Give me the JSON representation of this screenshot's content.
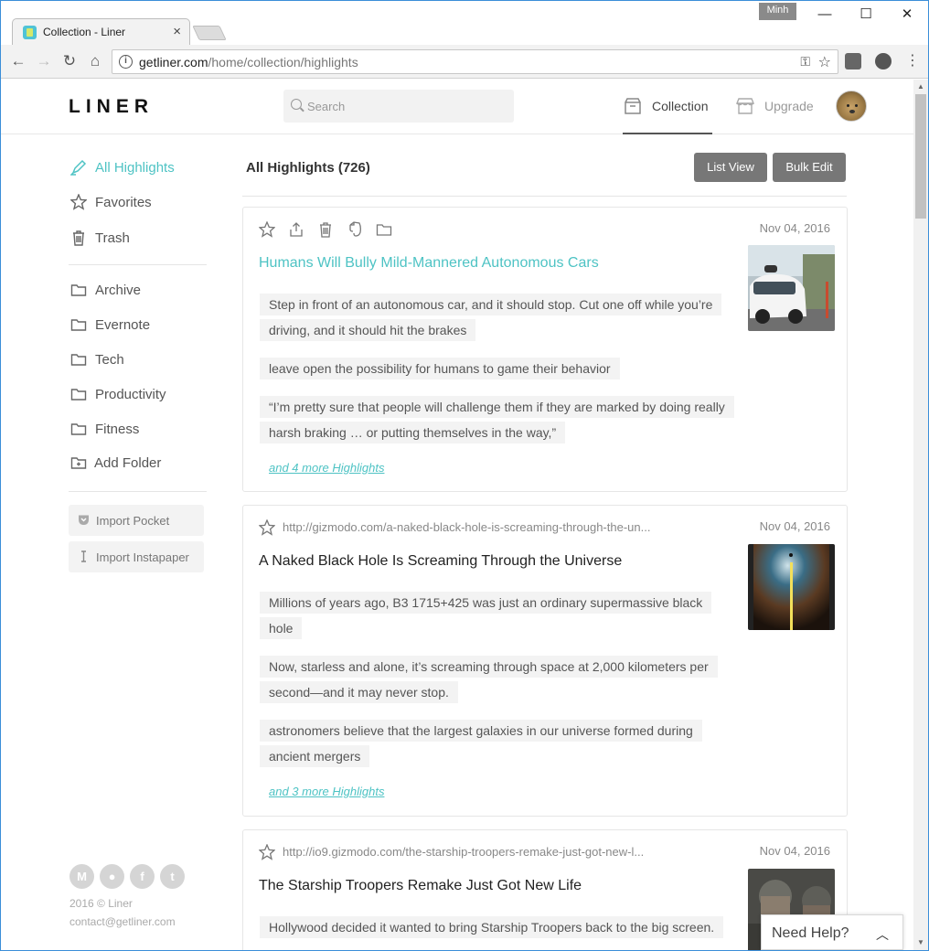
{
  "browser": {
    "tab_title": "Collection - Liner",
    "tab_close": "×",
    "user_badge": "Minh",
    "window_controls": {
      "minimize": "—",
      "maximize": "☐",
      "close": "✕"
    },
    "url_host": "getliner.com",
    "url_path": "/home/collection/highlights",
    "nav": {
      "back": "←",
      "forward": "→",
      "reload": "↻",
      "home": "⌂"
    },
    "menu": "⋮"
  },
  "header": {
    "logo": "LINER",
    "search_placeholder": "Search",
    "nav": [
      {
        "label": "Collection",
        "icon": "archive-box-icon",
        "active": true
      },
      {
        "label": "Upgrade",
        "icon": "storefront-icon",
        "active": false
      }
    ]
  },
  "sidebar": {
    "main": [
      {
        "label": "All Highlights",
        "icon": "highlighter-icon",
        "active": true
      },
      {
        "label": "Favorites",
        "icon": "star-icon",
        "active": false
      },
      {
        "label": "Trash",
        "icon": "trash-icon",
        "active": false
      }
    ],
    "folders": [
      {
        "label": "Archive",
        "icon": "folder-icon"
      },
      {
        "label": "Evernote",
        "icon": "folder-icon"
      },
      {
        "label": "Tech",
        "icon": "folder-icon"
      },
      {
        "label": "Productivity",
        "icon": "folder-icon"
      },
      {
        "label": "Fitness",
        "icon": "folder-icon"
      }
    ],
    "add_folder": "Add Folder",
    "imports": [
      {
        "label": "Import Pocket",
        "icon": "pocket-icon"
      },
      {
        "label": "Import Instapaper",
        "icon": "instapaper-icon"
      }
    ],
    "footer": {
      "social": [
        {
          "name": "medium-icon",
          "glyph": "M"
        },
        {
          "name": "reddit-icon",
          "glyph": "●"
        },
        {
          "name": "facebook-icon",
          "glyph": "f"
        },
        {
          "name": "twitter-icon",
          "glyph": "t"
        }
      ],
      "copyright": "2016 © Liner",
      "contact": "contact@getliner.com"
    }
  },
  "main": {
    "title": "All Highlights (726)",
    "list_view_label": "List View",
    "bulk_edit_label": "Bulk Edit",
    "cards": [
      {
        "date": "Nov 04, 2016",
        "title": "Humans Will Bully Mild-Mannered Autonomous Cars",
        "highlights": [
          "Step in front of an autonomous car, and it should stop. Cut one off while you’re driving, and it should hit the brakes",
          "leave open the possibility for humans to game their behavior",
          "“I’m pretty sure that people will challenge them if they are marked by doing really harsh braking … or putting themselves in the way,”"
        ],
        "more": "and 4 more Highlights"
      },
      {
        "date": "Nov 04, 2016",
        "source": "http://gizmodo.com/a-naked-black-hole-is-screaming-through-the-un...",
        "title": "A Naked Black Hole Is Screaming Through the Universe",
        "highlights": [
          "Millions of years ago, B3 1715+425 was just an ordinary supermassive black hole",
          "Now, starless and alone, it’s screaming through space at 2,000 kilometers per second—and it may never stop.",
          "astronomers believe that the largest galaxies in our universe formed during ancient mergers"
        ],
        "more": "and 3 more Highlights"
      },
      {
        "date": "Nov 04, 2016",
        "source": "http://io9.gizmodo.com/the-starship-troopers-remake-just-got-new-l...",
        "title": "The Starship Troopers Remake Just Got New Life",
        "highlights": [
          "Hollywood decided it wanted to bring Starship Troopers back to the big screen."
        ]
      }
    ]
  },
  "help": {
    "label": "Need Help?",
    "chevron": "︿"
  },
  "colors": {
    "accent": "#4ec3c4",
    "button_gray": "#777777"
  }
}
